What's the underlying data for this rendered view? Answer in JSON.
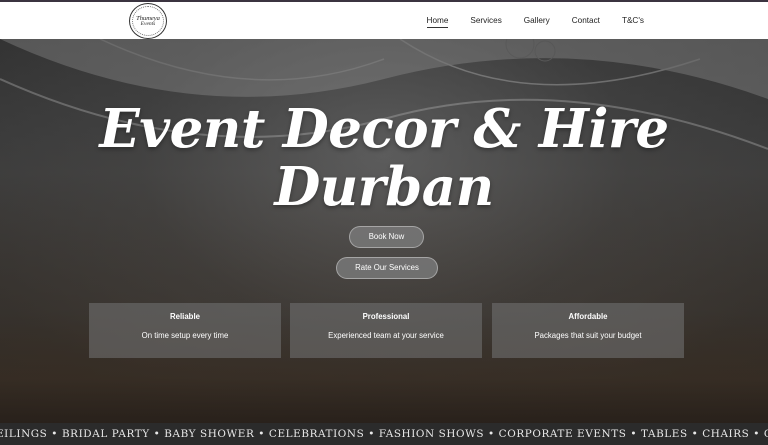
{
  "header": {
    "logo": {
      "line1": "Thumeya",
      "line2": "Events"
    },
    "nav": [
      {
        "label": "Home",
        "active": true
      },
      {
        "label": "Services"
      },
      {
        "label": "Gallery"
      },
      {
        "label": "Contact"
      },
      {
        "label": "T&C's"
      }
    ]
  },
  "hero": {
    "title_line1": "Event Decor & Hire",
    "title_line2": "Durban",
    "book_button": "Book Now",
    "rate_button": "Rate Our Services"
  },
  "features": [
    {
      "title": "Reliable",
      "desc": "On time setup every time"
    },
    {
      "title": "Professional",
      "desc": "Experienced team at your service"
    },
    {
      "title": "Affordable",
      "desc": "Packages that suit your budget"
    }
  ],
  "ticker": {
    "text": "EILINGS • BRIDAL PARTY • BABY SHOWER • CELEBRATIONS • FASHION SHOWS • CORPORATE EVENTS • TABLES • CHAIRS • CROCKERY • CUT"
  },
  "colors": {
    "header_bg": "#ffffff",
    "top_border": "#3b3440",
    "ticker_bg": "#2b2b2b",
    "button_bg": "#787878"
  }
}
